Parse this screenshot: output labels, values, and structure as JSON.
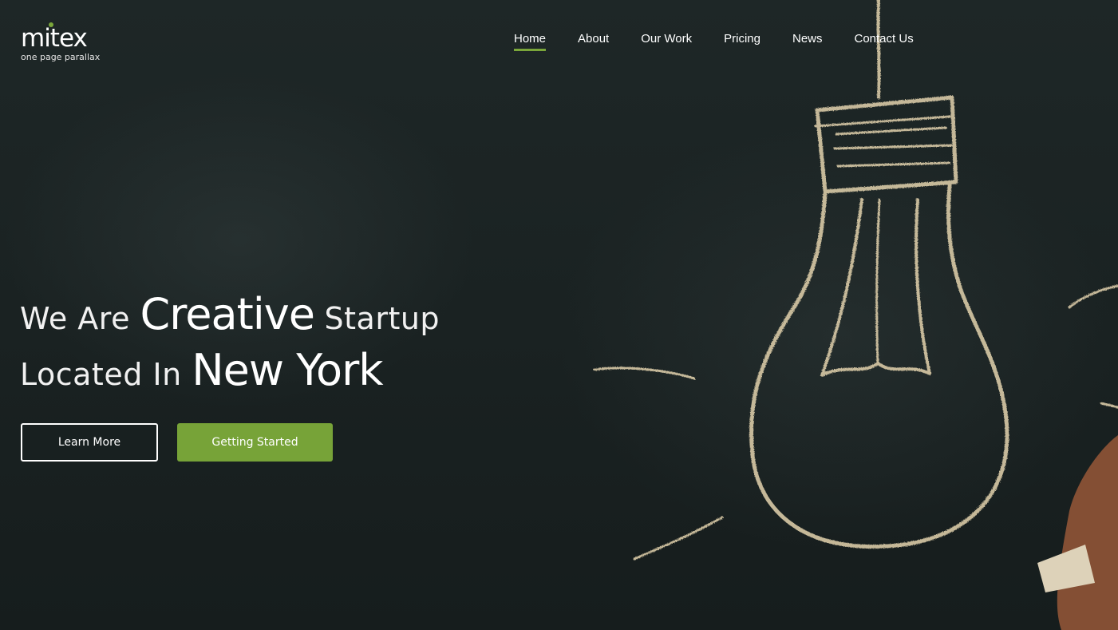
{
  "brand": {
    "logo_word": "mitex",
    "tagline": "one page parallax",
    "accent_color": "#77a338"
  },
  "nav": {
    "items": [
      {
        "label": "Home",
        "active": true
      },
      {
        "label": "About",
        "active": false
      },
      {
        "label": "Our Work",
        "active": false
      },
      {
        "label": "Pricing",
        "active": false
      },
      {
        "label": "News",
        "active": false
      },
      {
        "label": "Contact Us",
        "active": false
      }
    ]
  },
  "hero": {
    "line1": {
      "part1": "We Are ",
      "part2": "Creative",
      "part3": " Startup"
    },
    "line2": {
      "part1": "Located In ",
      "part2": "New York"
    }
  },
  "buttons": {
    "learn_more": "Learn More",
    "getting_started": "Getting Started"
  },
  "background": {
    "description_icon": "chalk-lightbulb-illustration"
  }
}
